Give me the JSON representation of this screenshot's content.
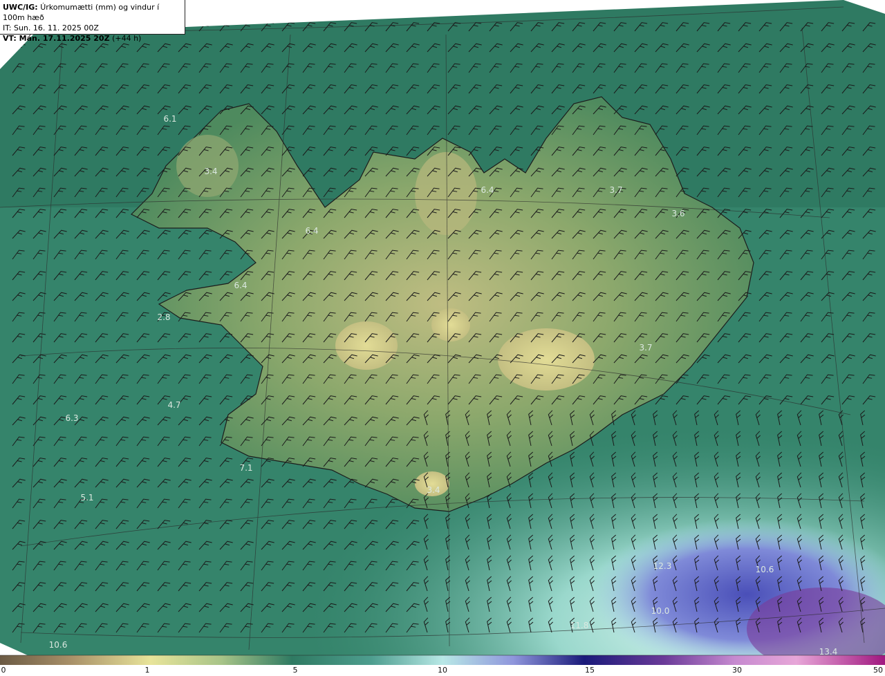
{
  "header": {
    "model": "UWC/IG:",
    "title": "Úrkomumætti (mm) og vindur í 100m hæð",
    "it_line": "IT: Sun. 16. 11. 2025 00Z",
    "vt_bold": "VT: Mán. 17.11.2025 20Z",
    "vt_lead": "(+44 h)"
  },
  "colorbar": {
    "ticks": [
      "0",
      "1",
      "5",
      "10",
      "15",
      "30",
      "50"
    ],
    "colors": [
      "#6b5a44",
      "#c8b37a",
      "#e8e49a",
      "#8fbf7e",
      "#2f7a62",
      "#4e9e8f",
      "#b8e8e6",
      "#7f86d8",
      "#1a1a7a",
      "#8a3a9a",
      "#e7a6d8",
      "#a0177f"
    ]
  },
  "map": {
    "ocean_colors": {
      "north": "#2f7d64",
      "south": "#7fc9bb",
      "far_south": "#b9ece8",
      "precip_heavy": "#5a6cc8"
    },
    "land_colors": {
      "low": "#4f8a5e",
      "mid": "#8aa86e",
      "high": "#c9c48a"
    }
  },
  "labels": [
    {
      "text": "6.1"
    },
    {
      "text": "3.4"
    },
    {
      "text": "6.4"
    },
    {
      "text": "6.4"
    },
    {
      "text": "2.8"
    },
    {
      "text": "6.4"
    },
    {
      "text": "3.7"
    },
    {
      "text": "3.6"
    },
    {
      "text": "3.7"
    },
    {
      "text": "4.7"
    },
    {
      "text": "6.3"
    },
    {
      "text": "7.1"
    },
    {
      "text": "5.1"
    },
    {
      "text": "3.4"
    },
    {
      "text": "12.3"
    },
    {
      "text": "10.6"
    },
    {
      "text": "10.0"
    },
    {
      "text": "11.8"
    },
    {
      "text": "10.6"
    },
    {
      "text": "13.4"
    }
  ]
}
